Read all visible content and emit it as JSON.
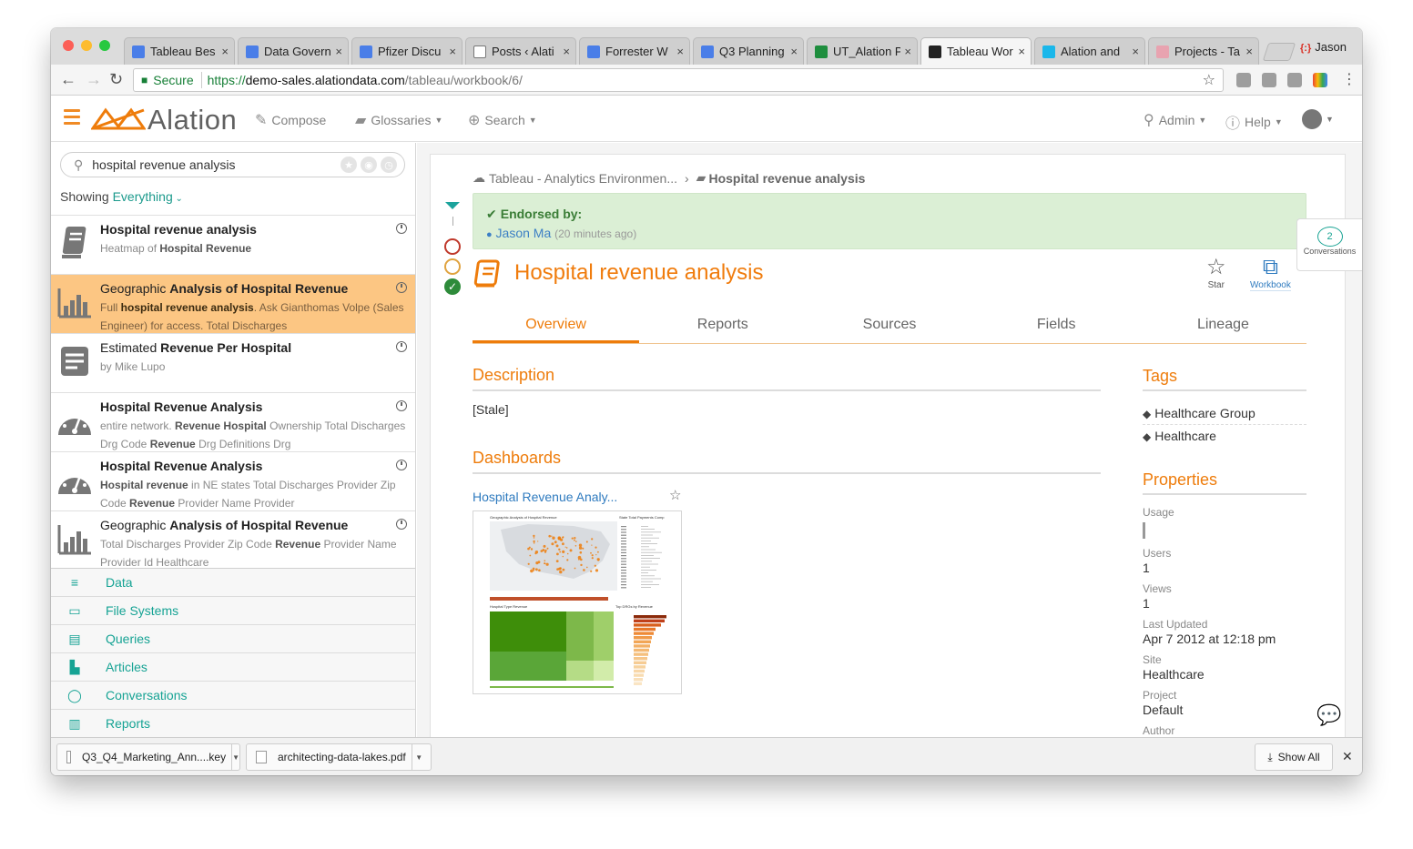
{
  "browser": {
    "tabs": [
      {
        "title": "Tableau Bes",
        "favicon_color": "#4a7ee8"
      },
      {
        "title": "Data Govern",
        "favicon_color": "#4a7ee8"
      },
      {
        "title": "Pfizer Discu",
        "favicon_color": "#4a7ee8"
      },
      {
        "title": "Posts ‹ Alati",
        "favicon_color": "#ffffff"
      },
      {
        "title": "Forrester W",
        "favicon_color": "#4a7ee8"
      },
      {
        "title": "Q3 Planning",
        "favicon_color": "#4a7ee8"
      },
      {
        "title": "UT_Alation P",
        "favicon_color": "#1e8e3e"
      },
      {
        "title": "Tableau Wor",
        "favicon_color": "#222222"
      },
      {
        "title": "Alation and",
        "favicon_color": "#1ab7ea"
      },
      {
        "title": "Projects - Ta",
        "favicon_color": "#e8a3b0"
      }
    ],
    "tab_close_glyph": "×",
    "profile_name": "Jason",
    "url_secure_label": "Secure",
    "url_scheme": "https://",
    "url_host": "demo-sales.alationdata.com",
    "url_path": "/tableau/workbook/6/"
  },
  "app": {
    "logo_text": "Alation",
    "brand_color": "#ee7c0b",
    "nav": [
      {
        "label": "Compose",
        "icon": "pen-icon"
      },
      {
        "label": "Glossaries",
        "icon": "book-icon"
      },
      {
        "label": "Search",
        "icon": "search-plus-icon"
      }
    ],
    "right_nav": [
      {
        "label": "Admin",
        "icon": "wrench-icon"
      },
      {
        "label": "Help",
        "icon": "info-icon"
      }
    ]
  },
  "sidebar": {
    "search_value": "hospital revenue analysis",
    "showing_label": "Showing",
    "showing_scope": "Everything",
    "results": [
      {
        "icon": "article-icon",
        "title_parts": [
          [
            "Hospital revenue analysis",
            true
          ]
        ],
        "desc_parts": [
          [
            "Heatmap of ",
            false
          ],
          [
            "Hospital Revenue",
            true
          ]
        ],
        "selected": false
      },
      {
        "icon": "bar-chart-icon",
        "title_parts": [
          [
            "Geographic ",
            false
          ],
          [
            "Analysis of Hospital Revenue",
            true
          ]
        ],
        "desc_parts": [
          [
            "Full ",
            false
          ],
          [
            "hospital revenue analysis",
            true
          ],
          [
            ". Ask Gianthomas Volpe (Sales Engineer) for access. Total Discharges",
            false
          ]
        ],
        "selected": true
      },
      {
        "icon": "table-icon",
        "title_parts": [
          [
            "Estimated ",
            false
          ],
          [
            "Revenue Per Hospital",
            true
          ]
        ],
        "desc_parts": [
          [
            "by Mike Lupo",
            false
          ]
        ],
        "selected": false
      },
      {
        "icon": "dashboard-icon",
        "title_parts": [
          [
            "Hospital Revenue Analysis",
            true
          ]
        ],
        "desc_parts": [
          [
            "entire network.   ",
            false
          ],
          [
            "Revenue Hospital",
            true
          ],
          [
            " Ownership Total Discharges Drg Code ",
            false
          ],
          [
            "Revenue",
            true
          ],
          [
            " Drg Definitions Drg",
            false
          ]
        ],
        "selected": false
      },
      {
        "icon": "dashboard-icon",
        "title_parts": [
          [
            "Hospital Revenue Analysis",
            true
          ]
        ],
        "desc_parts": [
          [
            "Hospital revenue",
            true
          ],
          [
            " in NE states Total Discharges Provider Zip Code ",
            false
          ],
          [
            "Revenue",
            true
          ],
          [
            " Provider Name Provider",
            false
          ]
        ],
        "selected": false
      },
      {
        "icon": "bar-chart-icon",
        "title_parts": [
          [
            "Geographic ",
            false
          ],
          [
            "Analysis of Hospital Revenue",
            true
          ]
        ],
        "desc_parts": [
          [
            "Total Discharges Provider Zip Code ",
            false
          ],
          [
            "Revenue",
            true
          ],
          [
            " Provider Name Provider Id Healthcare",
            false
          ]
        ],
        "selected": false
      },
      {
        "icon": "dashboard-icon",
        "title_parts": [
          [
            "Hospital Revenue Analysis",
            true
          ]
        ],
        "desc_parts": [],
        "selected": false
      }
    ],
    "categories": [
      {
        "label": "Data",
        "icon": "database-icon",
        "glyph": "≡"
      },
      {
        "label": "File Systems",
        "icon": "drive-icon",
        "glyph": "▭"
      },
      {
        "label": "Queries",
        "icon": "query-icon",
        "glyph": "▤"
      },
      {
        "label": "Articles",
        "icon": "article-icon",
        "glyph": "▙"
      },
      {
        "label": "Conversations",
        "icon": "chat-icon",
        "glyph": "◯"
      },
      {
        "label": "Reports",
        "icon": "bar-chart-icon",
        "glyph": "▥"
      }
    ]
  },
  "downloads": {
    "items": [
      {
        "name": "Q3_Q4_Marketing_Ann....key"
      },
      {
        "name": "architecting-data-lakes.pdf"
      }
    ],
    "show_all": "Show All"
  },
  "detail": {
    "breadcrumb_parent": "Tableau - Analytics Environmen...",
    "breadcrumb_sep": "›",
    "breadcrumb_current": "Hospital revenue analysis",
    "endorsed_label": "Endorsed by:",
    "endorser": "Jason Ma",
    "endorsed_when": "(20 minutes ago)",
    "title": "Hospital revenue analysis",
    "star_label": "Star",
    "workbook_label": "Workbook",
    "conversations_count": "2",
    "conversations_label": "Conversations",
    "tabs": [
      "Overview",
      "Reports",
      "Sources",
      "Fields",
      "Lineage"
    ],
    "description_heading": "Description",
    "description_text": "[Stale]",
    "dashboards_heading": "Dashboards",
    "dashboard_link": "Hospital Revenue Analy...",
    "thumb_title_left": "Geographic Analysis of Hospital Revenue",
    "thumb_title_right": "State Total Payments Comp",
    "thumb_label_treemap": "Hospital Type Revenue",
    "thumb_label_bars": "Top DRGs by Revenue",
    "tags_heading": "Tags",
    "tags": [
      "Healthcare Group",
      "Healthcare"
    ],
    "properties_heading": "Properties",
    "properties": [
      {
        "label": "Usage",
        "value": ""
      },
      {
        "label": "Users",
        "value": "1"
      },
      {
        "label": "Views",
        "value": "1"
      },
      {
        "label": "Last Updated",
        "value": "Apr 7 2012 at 12:18 pm"
      },
      {
        "label": "Site",
        "value": "Healthcare"
      },
      {
        "label": "Project",
        "value": "Default"
      },
      {
        "label": "Author",
        "value": ""
      }
    ]
  }
}
